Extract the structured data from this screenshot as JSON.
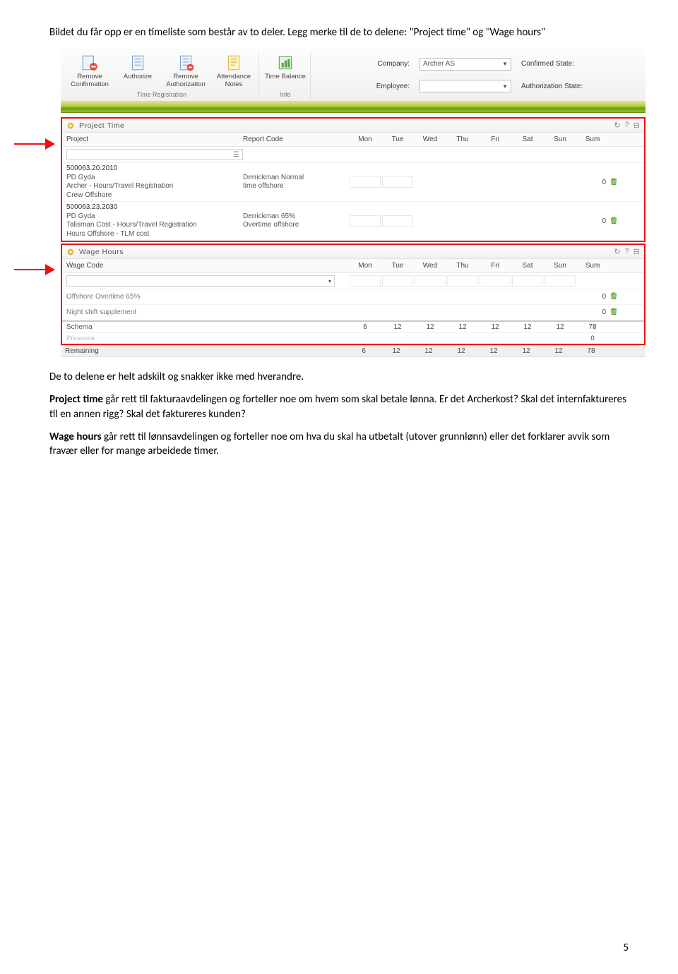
{
  "doc": {
    "intro": "Bildet du får opp er en timeliste som består av to deler. Legg merke til de to delene: \"Project time\" og \"Wage hours\"",
    "mid": "De to delene er helt adskilt og snakker ikke med hverandre.",
    "p_project_lead": "Project time",
    "p_project_rest": " går rett til fakturaavdelingen og forteller noe om hvem som skal betale lønna. Er det Archerkost? Skal det internfaktureres til en annen rigg? Skal det faktureres kunden?",
    "p_wage_lead": "Wage hours",
    "p_wage_rest": " går rett til lønnsavdelingen og forteller noe om hva du skal ha utbetalt (utover grunnlønn) eller det forklarer avvik som fravær eller for mange arbeidede timer.",
    "page": "5"
  },
  "ribbon": {
    "btns": [
      {
        "label1": "Remove",
        "label2": "Confirmation"
      },
      {
        "label1": "Authorize",
        "label2": ""
      },
      {
        "label1": "Remove",
        "label2": "Authorization"
      },
      {
        "label1": "Attendance",
        "label2": "Notes"
      },
      {
        "label1": "Time Balance",
        "label2": ""
      }
    ],
    "group1_caption": "Time Registration",
    "group2_caption": "Info",
    "fields": {
      "company_label": "Company:",
      "company_value": "Archer AS",
      "employee_label": "Employee:",
      "employee_value": "",
      "confirmed_label": "Confirmed State:",
      "auth_label": "Authorization State:"
    }
  },
  "projectTime": {
    "title": "Project Time",
    "cols": {
      "c1": "Project",
      "c2": "Report Code",
      "days": [
        "Mon",
        "Tue",
        "Wed",
        "Thu",
        "Fri",
        "Sat",
        "Sun"
      ],
      "sum": "Sum"
    },
    "rows": [
      {
        "code": "500063.20.2010",
        "lines": [
          "PD Gyda",
          "Archer - Hours/Travel Registration",
          "Crew Offshore"
        ],
        "rc": [
          "Derrickman Normal",
          "time offshore"
        ],
        "sum": "0"
      },
      {
        "code": "500063.23.2030",
        "lines": [
          "PD Gyda",
          "Talisman Cost - Hours/Travel Registration",
          "Hours Offshore - TLM cost"
        ],
        "rc": [
          "Derrickman 65%",
          "Overtime offshore"
        ],
        "sum": "0"
      }
    ]
  },
  "wageHours": {
    "title": "Wage Hours",
    "col1": "Wage Code",
    "days": [
      "Mon",
      "Tue",
      "Wed",
      "Thu",
      "Fri",
      "Sat",
      "Sun"
    ],
    "sum": "Sum",
    "rows": [
      {
        "label": "Offshore Overtime 65%",
        "sum": "0"
      },
      {
        "label": "Night shift supplement",
        "sum": "0"
      }
    ]
  },
  "summary": {
    "schema_label": "Schema",
    "schema": [
      "6",
      "12",
      "12",
      "12",
      "12",
      "12",
      "12",
      "78"
    ],
    "presence_label": "Presence",
    "presence_sum": "0",
    "remaining_label": "Remaining",
    "remaining": [
      "6",
      "12",
      "12",
      "12",
      "12",
      "12",
      "12",
      "78"
    ]
  }
}
